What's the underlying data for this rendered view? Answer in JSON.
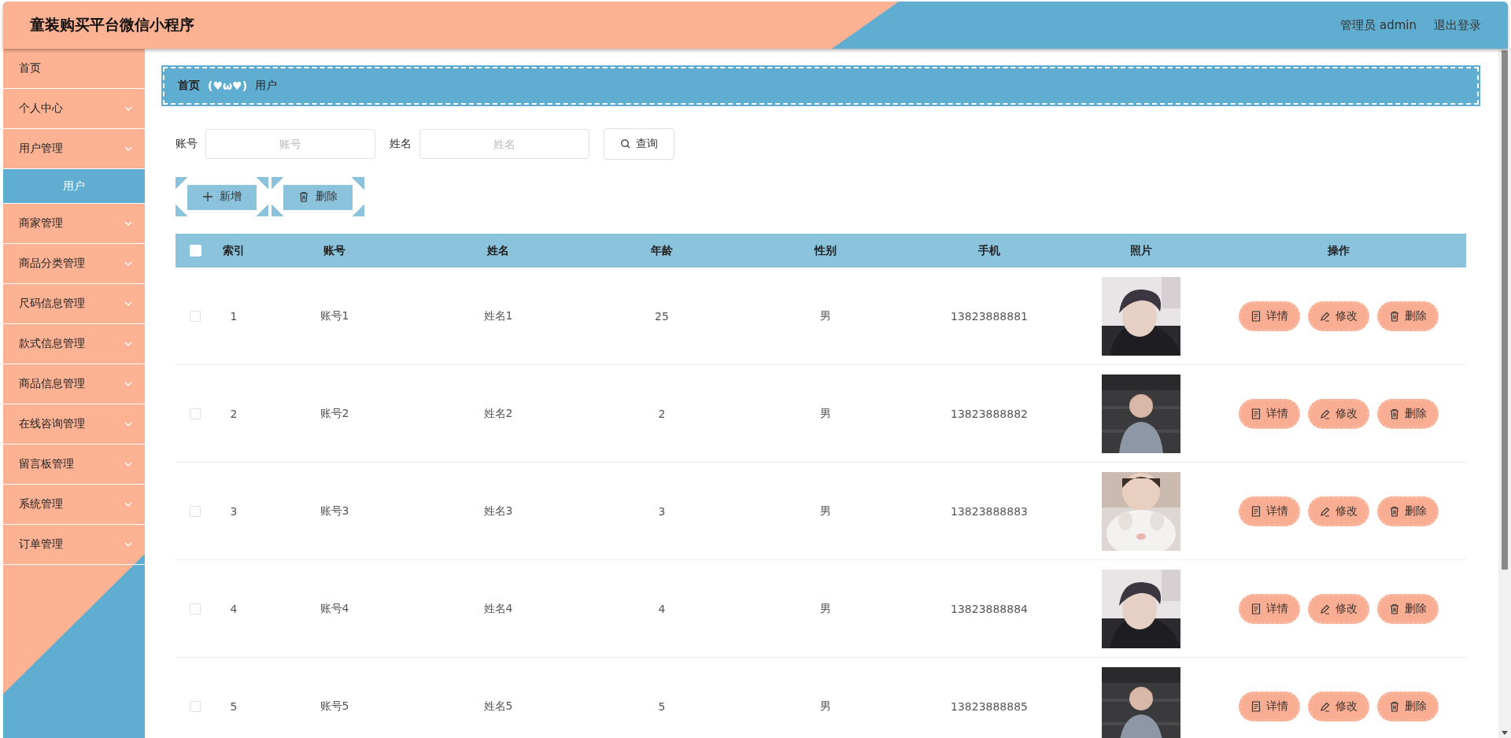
{
  "header": {
    "title": "童装购买平台微信小程序",
    "user": "管理员 admin",
    "logout": "退出登录"
  },
  "sidebar": {
    "items": [
      {
        "label": "首页",
        "kind": "link"
      },
      {
        "label": "个人中心",
        "kind": "group"
      },
      {
        "label": "用户管理",
        "kind": "group",
        "children": [
          {
            "label": "用户",
            "selected": true
          }
        ]
      },
      {
        "label": "商家管理",
        "kind": "group"
      },
      {
        "label": "商品分类管理",
        "kind": "group"
      },
      {
        "label": "尺码信息管理",
        "kind": "group"
      },
      {
        "label": "款式信息管理",
        "kind": "group"
      },
      {
        "label": "商品信息管理",
        "kind": "group"
      },
      {
        "label": "在线咨询管理",
        "kind": "group"
      },
      {
        "label": "留言板管理",
        "kind": "group"
      },
      {
        "label": "系统管理",
        "kind": "group"
      },
      {
        "label": "订单管理",
        "kind": "group"
      }
    ]
  },
  "breadcrumb": {
    "items": [
      "首页",
      "用户"
    ],
    "separator": "(♥ω♥)"
  },
  "search": {
    "fields": [
      {
        "label": "账号",
        "placeholder": "账号"
      },
      {
        "label": "姓名",
        "placeholder": "姓名"
      }
    ],
    "button": "查询"
  },
  "actions": [
    {
      "label": "新增",
      "kind": "add"
    },
    {
      "label": "删除",
      "kind": "delete"
    }
  ],
  "table": {
    "header_checkbox": {
      "checked": false
    },
    "columns": [
      "索引",
      "账号",
      "姓名",
      "年龄",
      "性别",
      "手机",
      "照片",
      "操作"
    ],
    "rows": [
      {
        "checked": false,
        "cells": [
          "1",
          "账号1",
          "姓名1",
          "25",
          "男",
          "13823888881"
        ],
        "actions": [
          {
            "label": "详情",
            "kind": "detail"
          },
          {
            "label": "修改",
            "kind": "edit"
          },
          {
            "label": "删除",
            "kind": "delete"
          }
        ]
      },
      {
        "checked": false,
        "cells": [
          "2",
          "账号2",
          "姓名2",
          "2",
          "男",
          "13823888882"
        ],
        "actions": [
          {
            "label": "详情",
            "kind": "detail"
          },
          {
            "label": "修改",
            "kind": "edit"
          },
          {
            "label": "删除",
            "kind": "delete"
          }
        ]
      },
      {
        "checked": false,
        "cells": [
          "3",
          "账号3",
          "姓名3",
          "3",
          "男",
          "13823888883"
        ],
        "actions": [
          {
            "label": "详情",
            "kind": "detail"
          },
          {
            "label": "修改",
            "kind": "edit"
          },
          {
            "label": "删除",
            "kind": "delete"
          }
        ]
      },
      {
        "checked": false,
        "cells": [
          "4",
          "账号4",
          "姓名4",
          "4",
          "男",
          "13823888884"
        ],
        "actions": [
          {
            "label": "详情",
            "kind": "detail"
          },
          {
            "label": "修改",
            "kind": "edit"
          },
          {
            "label": "删除",
            "kind": "delete"
          }
        ]
      },
      {
        "checked": false,
        "cells": [
          "5",
          "账号5",
          "姓名5",
          "5",
          "男",
          "13823888885"
        ],
        "actions": [
          {
            "label": "详情",
            "kind": "detail"
          },
          {
            "label": "修改",
            "kind": "edit"
          },
          {
            "label": "删除",
            "kind": "delete"
          }
        ]
      }
    ]
  }
}
